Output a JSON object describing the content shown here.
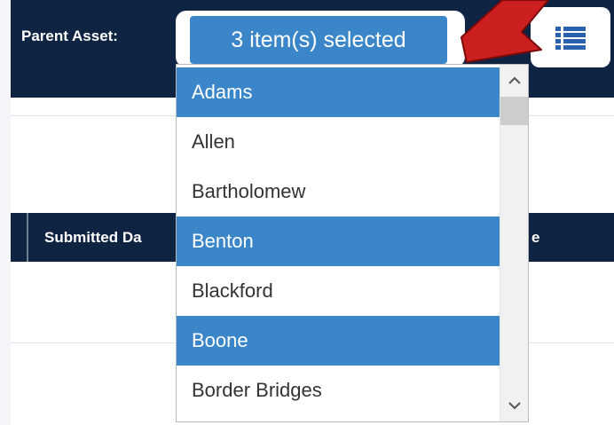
{
  "header": {
    "label": "Parent Asset:",
    "select_text": "3 item(s) selected"
  },
  "table": {
    "col_submitted": "Submitted Da",
    "col_right": "e"
  },
  "dropdown": {
    "items": [
      {
        "label": "Adams",
        "selected": true
      },
      {
        "label": "Allen",
        "selected": false
      },
      {
        "label": "Bartholomew",
        "selected": false
      },
      {
        "label": "Benton",
        "selected": true
      },
      {
        "label": "Blackford",
        "selected": false
      },
      {
        "label": "Boone",
        "selected": true
      },
      {
        "label": "Border Bridges",
        "selected": false
      }
    ]
  },
  "icons": {
    "list_button": "list-icon",
    "scroll_up": "chevron-up-icon",
    "scroll_down": "chevron-down-icon",
    "annotation": "red-arrow-icon"
  },
  "colors": {
    "navy": "#0f2342",
    "selected_blue": "#3a86c8",
    "arrow_red": "#cc1f1f"
  }
}
